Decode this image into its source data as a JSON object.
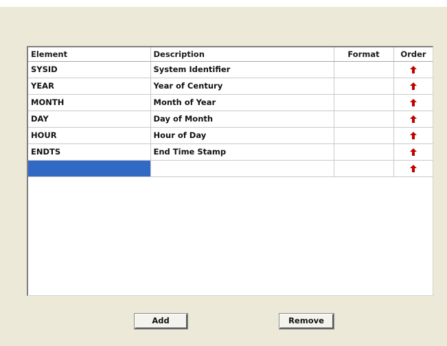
{
  "table": {
    "columns": [
      "Element",
      "Description",
      "Format",
      "Order"
    ],
    "rows": [
      {
        "element": "SYSID",
        "description": "System Identifier",
        "format": ""
      },
      {
        "element": "YEAR",
        "description": "Year of Century",
        "format": ""
      },
      {
        "element": "MONTH",
        "description": "Month of Year",
        "format": ""
      },
      {
        "element": "DAY",
        "description": "Day of Month",
        "format": ""
      },
      {
        "element": "HOUR",
        "description": "Hour of Day",
        "format": ""
      },
      {
        "element": "ENDTS",
        "description": "End Time Stamp",
        "format": ""
      },
      {
        "element": "",
        "description": "",
        "format": "",
        "selected": true
      }
    ],
    "order_icon": "up-arrow-icon",
    "order_icon_color": "#c00000",
    "selection_color": "#316ac5"
  },
  "buttons": {
    "add_label": "Add",
    "remove_label": "Remove"
  }
}
